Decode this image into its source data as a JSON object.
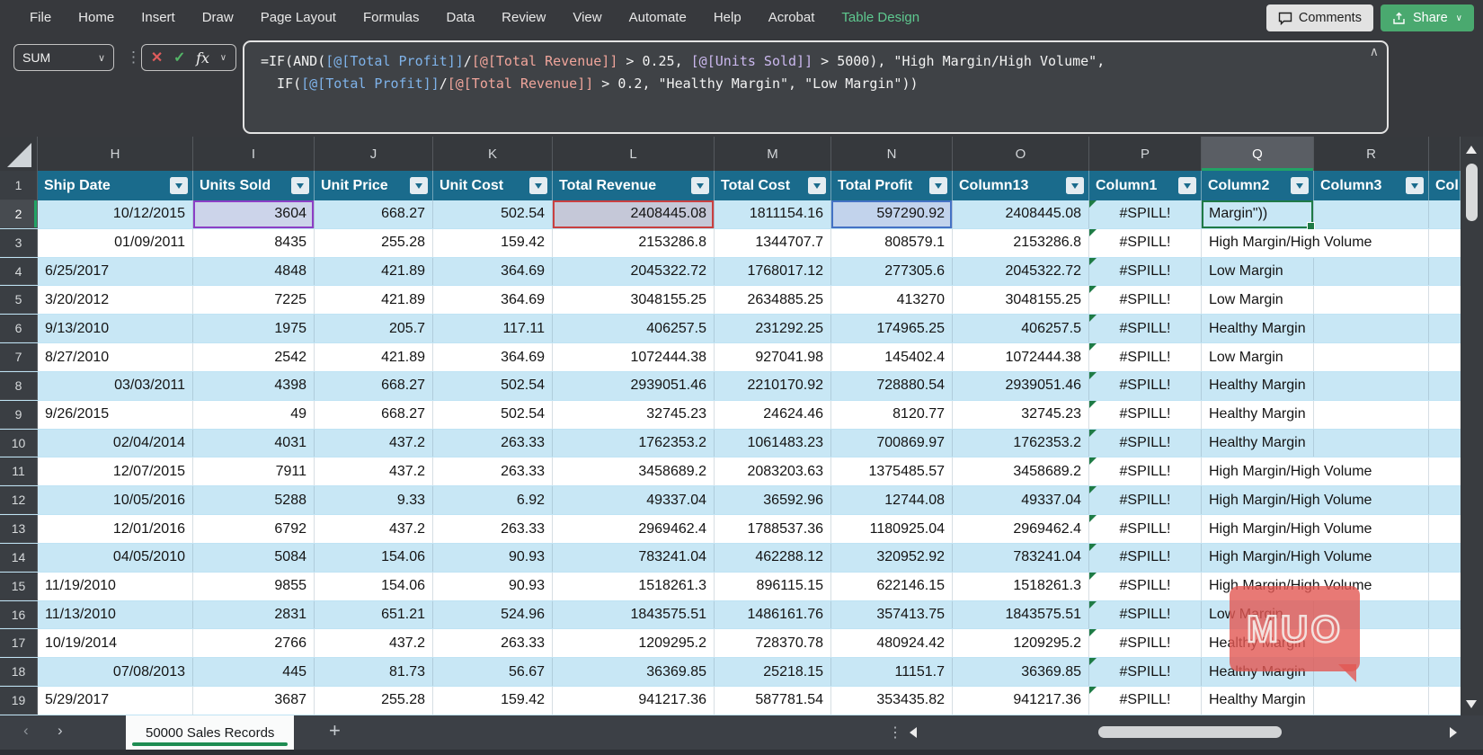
{
  "menu": {
    "items": [
      {
        "label": "File"
      },
      {
        "label": "Home"
      },
      {
        "label": "Insert"
      },
      {
        "label": "Draw"
      },
      {
        "label": "Page Layout"
      },
      {
        "label": "Formulas"
      },
      {
        "label": "Data"
      },
      {
        "label": "Review"
      },
      {
        "label": "View"
      },
      {
        "label": "Automate"
      },
      {
        "label": "Help"
      },
      {
        "label": "Acrobat"
      },
      {
        "label": "Table Design",
        "active": true
      }
    ]
  },
  "quick_actions": {
    "comments": "Comments",
    "share": "Share"
  },
  "icons": {
    "chevron_down": "∨",
    "collapse": "∧",
    "cancel": "✕",
    "enter": "✓",
    "fx": "fx",
    "dots_vertical": "⋮",
    "tab_prev": "‹",
    "tab_next": "›",
    "add_sheet": "+"
  },
  "formula_bar": {
    "name_box": "SUM",
    "lines": [
      [
        {
          "t": "=IF(AND(",
          "c": "w"
        },
        {
          "t": "[@[Total Profit]]",
          "c": "b"
        },
        {
          "t": "/",
          "c": "w"
        },
        {
          "t": "[@[Total Revenue]]",
          "c": "r"
        },
        {
          "t": " > 0.25, ",
          "c": "w"
        },
        {
          "t": "[@[Units Sold]]",
          "c": "p"
        },
        {
          "t": " > 5000), \"High Margin/High Volume\",",
          "c": "w"
        }
      ],
      [
        {
          "t": "  IF(",
          "c": "w"
        },
        {
          "t": "[@[Total Profit]]",
          "c": "b"
        },
        {
          "t": "/",
          "c": "w"
        },
        {
          "t": "[@[Total Revenue]]",
          "c": "r"
        },
        {
          "t": " > 0.2, \"Healthy Margin\", \"Low Margin\"))",
          "c": "w"
        }
      ]
    ]
  },
  "table": {
    "headers": [
      {
        "letter": "H",
        "label": "Ship Date"
      },
      {
        "letter": "I",
        "label": "Units Sold"
      },
      {
        "letter": "J",
        "label": "Unit Price"
      },
      {
        "letter": "K",
        "label": "Unit Cost"
      },
      {
        "letter": "L",
        "label": "Total Revenue"
      },
      {
        "letter": "M",
        "label": "Total Cost"
      },
      {
        "letter": "N",
        "label": "Total Profit"
      },
      {
        "letter": "O",
        "label": "Column13"
      },
      {
        "letter": "P",
        "label": "Column1"
      },
      {
        "letter": "Q",
        "label": "Column2",
        "selected": true
      },
      {
        "letter": "R",
        "label": "Column3"
      },
      {
        "letter": "",
        "label": "Col",
        "partial": true
      }
    ],
    "rows": [
      {
        "n": 2,
        "band": true,
        "date": "10/12/2015",
        "date_align": "right",
        "units": "3604",
        "price": "668.27",
        "cost": "502.54",
        "revenue": "2408445.08",
        "tcost": "1811154.16",
        "profit": "597290.92",
        "c13": "2408445.08",
        "col1": "#SPILL!",
        "col2": "Margin\"))"
      },
      {
        "n": 3,
        "band": false,
        "date": "01/09/2011",
        "date_align": "right",
        "units": "8435",
        "price": "255.28",
        "cost": "159.42",
        "revenue": "2153286.8",
        "tcost": "1344707.7",
        "profit": "808579.1",
        "c13": "2153286.8",
        "col1": "#SPILL!",
        "col2": "High Margin/High Volume"
      },
      {
        "n": 4,
        "band": true,
        "date": "6/25/2017",
        "date_align": "left",
        "units": "4848",
        "price": "421.89",
        "cost": "364.69",
        "revenue": "2045322.72",
        "tcost": "1768017.12",
        "profit": "277305.6",
        "c13": "2045322.72",
        "col1": "#SPILL!",
        "col2": "Low Margin"
      },
      {
        "n": 5,
        "band": false,
        "date": "3/20/2012",
        "date_align": "left",
        "units": "7225",
        "price": "421.89",
        "cost": "364.69",
        "revenue": "3048155.25",
        "tcost": "2634885.25",
        "profit": "413270",
        "c13": "3048155.25",
        "col1": "#SPILL!",
        "col2": "Low Margin"
      },
      {
        "n": 6,
        "band": true,
        "date": "9/13/2010",
        "date_align": "left",
        "units": "1975",
        "price": "205.7",
        "cost": "117.11",
        "revenue": "406257.5",
        "tcost": "231292.25",
        "profit": "174965.25",
        "c13": "406257.5",
        "col1": "#SPILL!",
        "col2": "Healthy Margin"
      },
      {
        "n": 7,
        "band": false,
        "date": "8/27/2010",
        "date_align": "left",
        "units": "2542",
        "price": "421.89",
        "cost": "364.69",
        "revenue": "1072444.38",
        "tcost": "927041.98",
        "profit": "145402.4",
        "c13": "1072444.38",
        "col1": "#SPILL!",
        "col2": "Low Margin"
      },
      {
        "n": 8,
        "band": true,
        "date": "03/03/2011",
        "date_align": "right",
        "units": "4398",
        "price": "668.27",
        "cost": "502.54",
        "revenue": "2939051.46",
        "tcost": "2210170.92",
        "profit": "728880.54",
        "c13": "2939051.46",
        "col1": "#SPILL!",
        "col2": "Healthy Margin"
      },
      {
        "n": 9,
        "band": false,
        "date": "9/26/2015",
        "date_align": "left",
        "units": "49",
        "price": "668.27",
        "cost": "502.54",
        "revenue": "32745.23",
        "tcost": "24624.46",
        "profit": "8120.77",
        "c13": "32745.23",
        "col1": "#SPILL!",
        "col2": "Healthy Margin"
      },
      {
        "n": 10,
        "band": true,
        "date": "02/04/2014",
        "date_align": "right",
        "units": "4031",
        "price": "437.2",
        "cost": "263.33",
        "revenue": "1762353.2",
        "tcost": "1061483.23",
        "profit": "700869.97",
        "c13": "1762353.2",
        "col1": "#SPILL!",
        "col2": "Healthy Margin"
      },
      {
        "n": 11,
        "band": false,
        "date": "12/07/2015",
        "date_align": "right",
        "units": "7911",
        "price": "437.2",
        "cost": "263.33",
        "revenue": "3458689.2",
        "tcost": "2083203.63",
        "profit": "1375485.57",
        "c13": "3458689.2",
        "col1": "#SPILL!",
        "col2": "High Margin/High Volume"
      },
      {
        "n": 12,
        "band": true,
        "date": "10/05/2016",
        "date_align": "right",
        "units": "5288",
        "price": "9.33",
        "cost": "6.92",
        "revenue": "49337.04",
        "tcost": "36592.96",
        "profit": "12744.08",
        "c13": "49337.04",
        "col1": "#SPILL!",
        "col2": "High Margin/High Volume"
      },
      {
        "n": 13,
        "band": false,
        "date": "12/01/2016",
        "date_align": "right",
        "units": "6792",
        "price": "437.2",
        "cost": "263.33",
        "revenue": "2969462.4",
        "tcost": "1788537.36",
        "profit": "1180925.04",
        "c13": "2969462.4",
        "col1": "#SPILL!",
        "col2": "High Margin/High Volume"
      },
      {
        "n": 14,
        "band": true,
        "date": "04/05/2010",
        "date_align": "right",
        "units": "5084",
        "price": "154.06",
        "cost": "90.93",
        "revenue": "783241.04",
        "tcost": "462288.12",
        "profit": "320952.92",
        "c13": "783241.04",
        "col1": "#SPILL!",
        "col2": "High Margin/High Volume"
      },
      {
        "n": 15,
        "band": false,
        "date": "11/19/2010",
        "date_align": "left",
        "units": "9855",
        "price": "154.06",
        "cost": "90.93",
        "revenue": "1518261.3",
        "tcost": "896115.15",
        "profit": "622146.15",
        "c13": "1518261.3",
        "col1": "#SPILL!",
        "col2": "High Margin/High Volume"
      },
      {
        "n": 16,
        "band": true,
        "date": "11/13/2010",
        "date_align": "left",
        "units": "2831",
        "price": "651.21",
        "cost": "524.96",
        "revenue": "1843575.51",
        "tcost": "1486161.76",
        "profit": "357413.75",
        "c13": "1843575.51",
        "col1": "#SPILL!",
        "col2": "Low Margin"
      },
      {
        "n": 17,
        "band": false,
        "date": "10/19/2014",
        "date_align": "left",
        "units": "2766",
        "price": "437.2",
        "cost": "263.33",
        "revenue": "1209295.2",
        "tcost": "728370.78",
        "profit": "480924.42",
        "c13": "1209295.2",
        "col1": "#SPILL!",
        "col2": "Healthy Margin"
      },
      {
        "n": 18,
        "band": true,
        "date": "07/08/2013",
        "date_align": "right",
        "units": "445",
        "price": "81.73",
        "cost": "56.67",
        "revenue": "36369.85",
        "tcost": "25218.15",
        "profit": "11151.7",
        "c13": "36369.85",
        "col1": "#SPILL!",
        "col2": "Healthy Margin"
      },
      {
        "n": 19,
        "band": false,
        "date": "5/29/2017",
        "date_align": "left",
        "units": "3687",
        "price": "255.28",
        "cost": "159.42",
        "revenue": "941217.36",
        "tcost": "587781.54",
        "profit": "353435.82",
        "c13": "941217.36",
        "col1": "#SPILL!",
        "col2": "Healthy Margin"
      }
    ]
  },
  "sheet_tabs": {
    "tabs": [
      {
        "label": "50000 Sales Records",
        "active": true
      }
    ]
  },
  "watermark": {
    "text": "MUO"
  },
  "colors": {
    "table_header_fill": "#1a6b8c",
    "band_fill": "#c8e7f5",
    "accent_green": "#21a366",
    "active_cell_border": "#1f7a46",
    "highlight_purple": "#8b3fc6",
    "highlight_red": "#c94040",
    "highlight_blue": "#4472c4",
    "active_ribbon_tab_text": "#5ec88f",
    "share_button": "#4aa96f"
  }
}
